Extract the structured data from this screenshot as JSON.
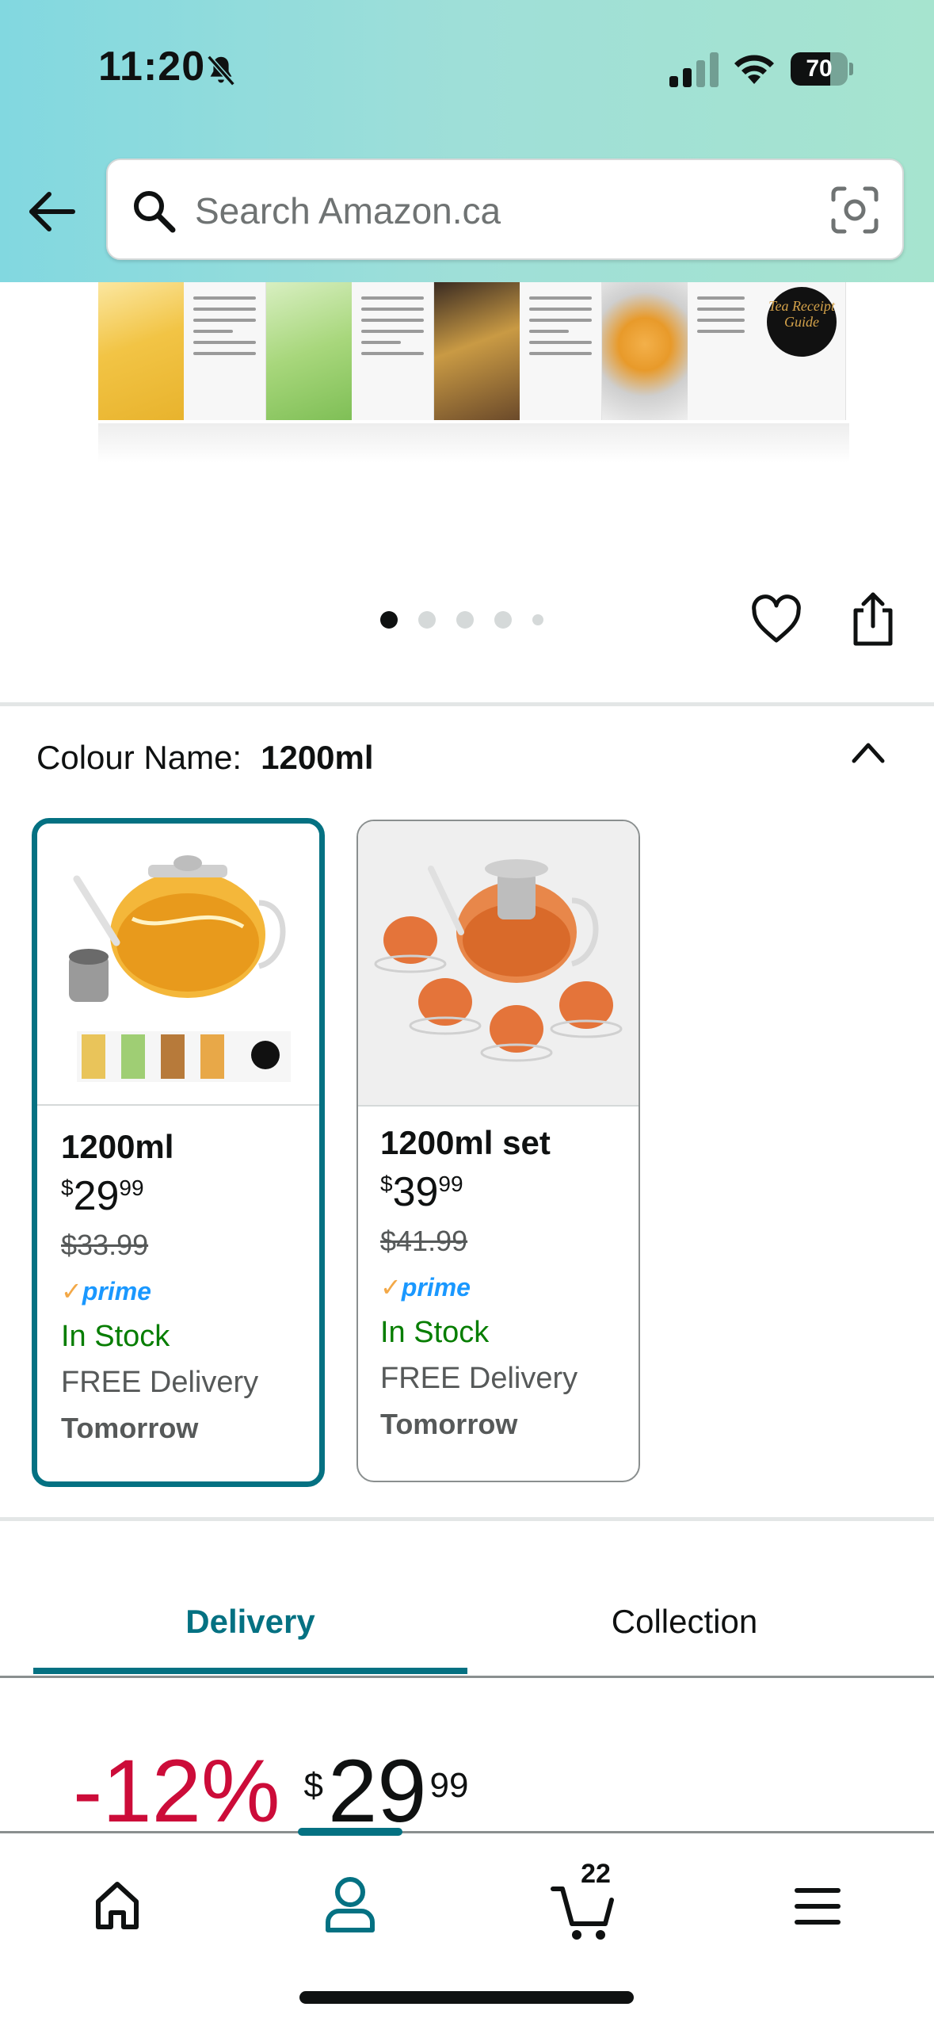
{
  "status_bar": {
    "time": "11:20",
    "battery": "70",
    "battery_level": 0.7
  },
  "search": {
    "placeholder": "Search Amazon.ca"
  },
  "gallery": {
    "page_count": 5,
    "active_index": 0,
    "guide_badge": "Tea Receipt Guide"
  },
  "colour": {
    "label": "Colour Name:",
    "selected": "1200ml"
  },
  "variants": [
    {
      "name": "1200ml",
      "currency": "$",
      "price_whole": "29",
      "price_fraction": "99",
      "old_price": "$33.99",
      "prime": "prime",
      "stock": "In Stock",
      "delivery": "FREE Delivery",
      "when": "Tomorrow"
    },
    {
      "name": "1200ml set",
      "currency": "$",
      "price_whole": "39",
      "price_fraction": "99",
      "old_price": "$41.99",
      "prime": "prime",
      "stock": "In Stock",
      "delivery": "FREE Delivery",
      "when": "Tomorrow"
    }
  ],
  "tabs": {
    "delivery": "Delivery",
    "collection": "Collection"
  },
  "price": {
    "discount": "-12%",
    "currency": "$",
    "whole": "29",
    "fraction": "99"
  },
  "bottom_nav": {
    "cart_count": "22"
  },
  "colors": {
    "accent": "#047182",
    "discount": "#cc0c39",
    "in_stock": "#067d00",
    "prime": "#1a98ff"
  }
}
